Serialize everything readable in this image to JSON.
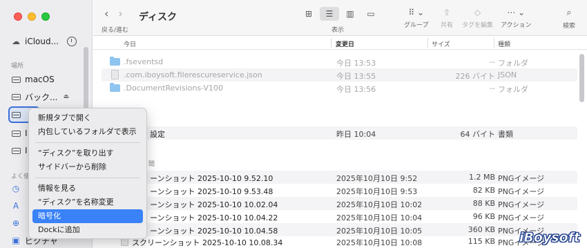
{
  "window": {
    "title": "ディスク"
  },
  "toolbar": {
    "nav_label": "戻る/進む",
    "view_label": "表示",
    "group_label": "グループ",
    "share_label": "共有",
    "tags_label": "タグを編集",
    "action_label": "アクション",
    "search_label": "検索"
  },
  "sidebar": {
    "icloud_label": "iCloud...",
    "places_heading": "場所",
    "macos_label": "macOS",
    "backup_label": "バック...",
    "favorites_heading": "よく使",
    "pictures_label": "ピクチャ",
    "disk_b_label": "I",
    "disk_c_label": "I"
  },
  "columns": {
    "name": "今日",
    "date": "変更日",
    "size": "サイズ",
    "kind": "種類"
  },
  "rows_top": [
    {
      "name": ".fseventsd",
      "date": "今日 13:53",
      "size": "--",
      "kind": "フォルダ",
      "icon": "folder-icon"
    },
    {
      "name": ".com.iboysoft.filerescureservice.json",
      "date": "今日 13:55",
      "size": "226 バイト",
      "kind": "JSON",
      "icon": "file-icon"
    },
    {
      "name": ".DocumentRevisions-V100",
      "date": "今日 13:56",
      "size": "--",
      "kind": "フォルダ",
      "icon": "folder-locked-icon"
    }
  ],
  "row_settings": {
    "name": "設定",
    "date": "昨日 10:04",
    "size": "64 バイト",
    "kind": "書類"
  },
  "group_label_2": "間",
  "rows_screens": [
    {
      "name": "ーンショット 2025-10-10 9.52.10",
      "date": "2025年10月10日 9:52",
      "size": "1.2 MB",
      "kind": "PNGイメージ"
    },
    {
      "name": "ーンショット 2025-10-10 9.53.48",
      "date": "2025年10月10日 9:53",
      "size": "82 KB",
      "kind": "PNGイメージ"
    },
    {
      "name": "ーンショット 2025-10-10 10.02.04",
      "date": "2025年10月10日 10:02",
      "size": "88 KB",
      "kind": "PNGイメージ"
    },
    {
      "name": "ーンショット 2025-10-10 10.04.22",
      "date": "2025年10月10日 10:04",
      "size": "96 KB",
      "kind": "PNGイメージ"
    },
    {
      "name": "ーンショット 2025-10-10 10.04.58",
      "date": "2025年10月10日 10:05",
      "size": "360 KB",
      "kind": "PNGイメージ"
    },
    {
      "name": "スクリーンショット 2025-10-10 10.08.34",
      "date": "2025年10月10日 10:08",
      "size": "115 KB",
      "kind": "PNGイメージ"
    }
  ],
  "context_menu": {
    "group1": [
      "新規タブで開く",
      "内包しているフォルダで表示"
    ],
    "group2": [
      "“ディスク”を取り出す",
      "サイドバーから削除"
    ],
    "group3": [
      "情報を見る",
      "“ディスク”を名称変更",
      "暗号化",
      "Dockに追加"
    ],
    "active_item": "暗号化"
  },
  "watermark": "iBoysoft"
}
